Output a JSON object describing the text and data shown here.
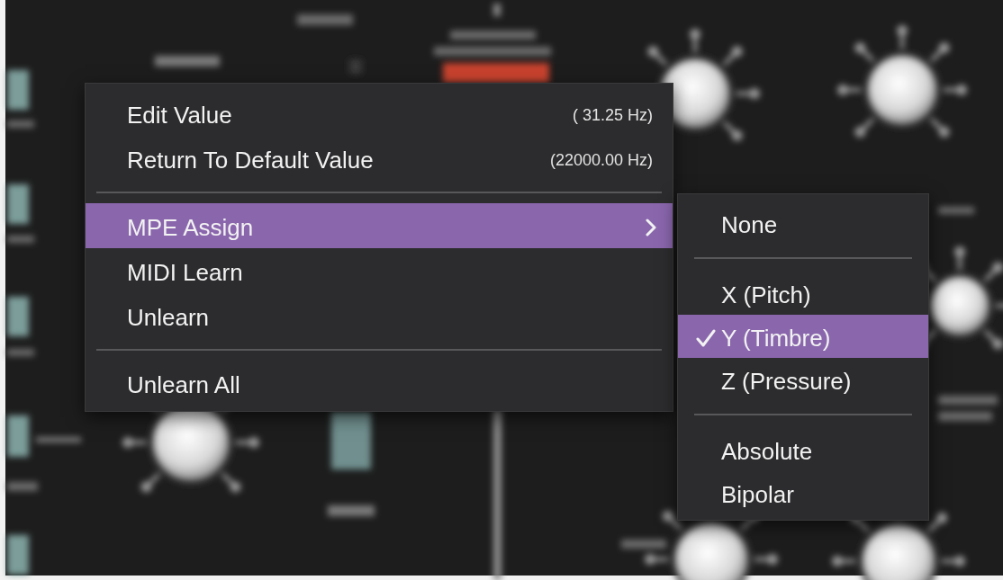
{
  "context_menu": {
    "items": [
      {
        "kind": "action",
        "label": "Edit Value",
        "value": "( 31.25 Hz)",
        "selected": false
      },
      {
        "kind": "action",
        "label": "Return To Default Value",
        "value": "(22000.00 Hz)",
        "selected": false
      },
      {
        "kind": "separator"
      },
      {
        "kind": "submenu",
        "label": "MPE Assign",
        "selected": true
      },
      {
        "kind": "action",
        "label": "MIDI Learn",
        "selected": false
      },
      {
        "kind": "action",
        "label": "Unlearn",
        "selected": false
      },
      {
        "kind": "separator"
      },
      {
        "kind": "action",
        "label": "Unlearn All",
        "selected": false
      }
    ]
  },
  "submenu": {
    "items": [
      {
        "kind": "option",
        "label": "None",
        "checked": false,
        "selected": false
      },
      {
        "kind": "separator"
      },
      {
        "kind": "option",
        "label": "X (Pitch)",
        "checked": false,
        "selected": false
      },
      {
        "kind": "option",
        "label": "Y (Timbre)",
        "checked": true,
        "selected": true
      },
      {
        "kind": "option",
        "label": "Z (Pressure)",
        "checked": false,
        "selected": false
      },
      {
        "kind": "separator"
      },
      {
        "kind": "option",
        "label": "Absolute",
        "checked": false,
        "selected": false
      },
      {
        "kind": "option",
        "label": "Bipolar",
        "checked": false,
        "selected": false
      }
    ]
  }
}
